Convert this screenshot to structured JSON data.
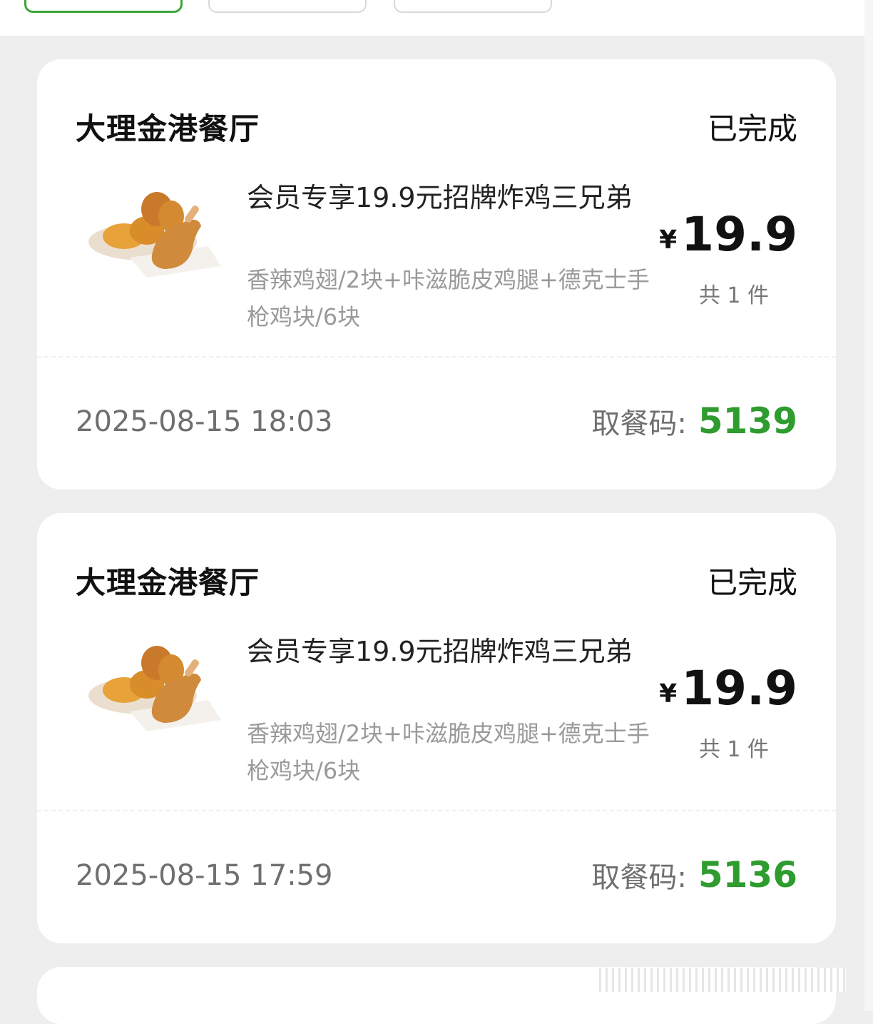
{
  "orders": [
    {
      "store": "大理金港餐厅",
      "status": "已完成",
      "item_name": "会员专享19.9元招牌炸鸡三兄弟",
      "item_desc": "香辣鸡翅/2块+咔滋脆皮鸡腿+德克士手枪鸡块/6块",
      "currency": "¥",
      "price": "19.9",
      "quantity": "共 1 件",
      "time": "2025-08-15 18:03",
      "pickup_label": "取餐码:",
      "pickup_code": "5139"
    },
    {
      "store": "大理金港餐厅",
      "status": "已完成",
      "item_name": "会员专享19.9元招牌炸鸡三兄弟",
      "item_desc": "香辣鸡翅/2块+咔滋脆皮鸡腿+德克士手枪鸡块/6块",
      "currency": "¥",
      "price": "19.9",
      "quantity": "共 1 件",
      "time": "2025-08-15 17:59",
      "pickup_label": "取餐码:",
      "pickup_code": "5136"
    }
  ],
  "colors": {
    "accent_green": "#2e9c2e",
    "background": "#eeeeee",
    "card": "#ffffff"
  }
}
